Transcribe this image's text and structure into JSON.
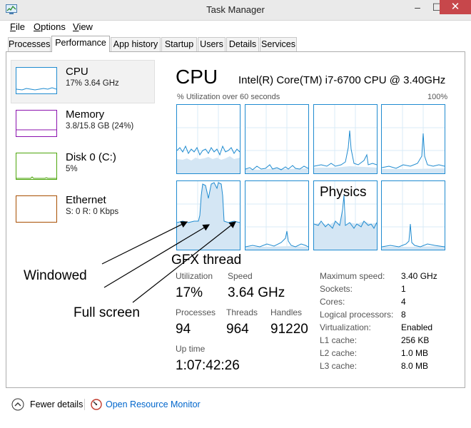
{
  "window": {
    "title": "Task Manager"
  },
  "menu": [
    {
      "key": "F",
      "rest": "ile"
    },
    {
      "key": "O",
      "rest": "ptions"
    },
    {
      "key": "V",
      "rest": "iew"
    }
  ],
  "tabs": [
    "Processes",
    "Performance",
    "App history",
    "Startup",
    "Users",
    "Details",
    "Services"
  ],
  "sidebar": [
    {
      "name": "CPU",
      "sub": "17%  3.64 GHz",
      "color": "#1f8bd0"
    },
    {
      "name": "Memory",
      "sub": "3.8/15.8 GB (24%)",
      "color": "#8b12ae"
    },
    {
      "name": "Disk 0 (C:)",
      "sub": "5%",
      "color": "#4da60c"
    },
    {
      "name": "Ethernet",
      "sub": "S: 0 R: 0 Kbps",
      "color": "#a74f01"
    }
  ],
  "main": {
    "title": "CPU",
    "model": "Intel(R) Core(TM) i7-6700 CPU @ 3.40GHz",
    "util_label": "% Utilization over 60 seconds",
    "util_max": "100%"
  },
  "stats": {
    "utilization_label": "Utilization",
    "utilization": "17%",
    "speed_label": "Speed",
    "speed": "3.64 GHz",
    "processes_label": "Processes",
    "processes": "94",
    "threads_label": "Threads",
    "threads": "964",
    "handles_label": "Handles",
    "handles": "91220",
    "uptime_label": "Up time",
    "uptime": "1:07:42:26"
  },
  "info": [
    {
      "label": "Maximum speed:",
      "value": "3.40 GHz"
    },
    {
      "label": "Sockets:",
      "value": "1"
    },
    {
      "label": "Cores:",
      "value": "4"
    },
    {
      "label": "Logical processors:",
      "value": "8"
    },
    {
      "label": "Virtualization:",
      "value": "Enabled"
    },
    {
      "label": "L1 cache:",
      "value": "256 KB"
    },
    {
      "label": "L2 cache:",
      "value": "1.0 MB"
    },
    {
      "label": "L3 cache:",
      "value": "8.0 MB"
    }
  ],
  "annotations": {
    "physics": "Physics",
    "gfx": "GFX thread",
    "windowed": "Windowed",
    "fullscreen": "Full screen"
  },
  "footer": {
    "fewer_details": "Fewer details",
    "resource_monitor": "Open Resource Monitor"
  },
  "colors": {
    "cpu": "#1f8bd0",
    "cpu_fill": "#d4e6f4",
    "link": "#0066cc"
  }
}
